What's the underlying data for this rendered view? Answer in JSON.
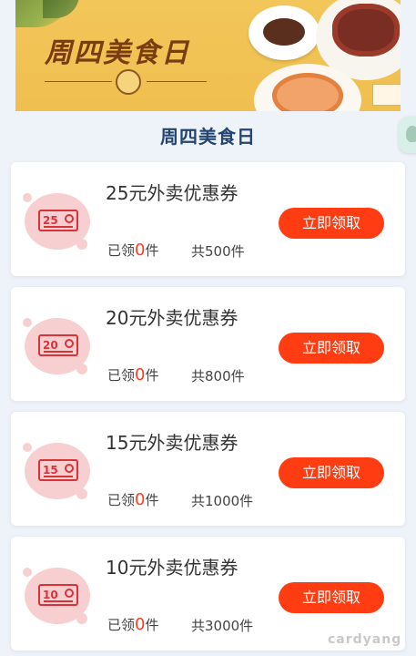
{
  "banner": {
    "title": "周四美食日",
    "logo_text": "周四美食日"
  },
  "section": {
    "title": "周四美食日"
  },
  "coupons": [
    {
      "badge": "25",
      "title": "25元外卖优惠券",
      "claimed_prefix": "已领",
      "claimed_count": "0",
      "claimed_suffix": "件",
      "total": "共500件",
      "button": "立即领取"
    },
    {
      "badge": "20",
      "title": "20元外卖优惠券",
      "claimed_prefix": "已领",
      "claimed_count": "0",
      "claimed_suffix": "件",
      "total": "共800件",
      "button": "立即领取"
    },
    {
      "badge": "15",
      "title": "15元外卖优惠券",
      "claimed_prefix": "已领",
      "claimed_count": "0",
      "claimed_suffix": "件",
      "total": "共1000件",
      "button": "立即领取"
    },
    {
      "badge": "10",
      "title": "10元外卖优惠券",
      "claimed_prefix": "已领",
      "claimed_count": "0",
      "claimed_suffix": "件",
      "total": "共3000件",
      "button": "立即领取"
    }
  ],
  "watermark": "cardyang",
  "colors": {
    "accent": "#ff3c12",
    "title": "#23456f",
    "badge": "#d9333a"
  }
}
